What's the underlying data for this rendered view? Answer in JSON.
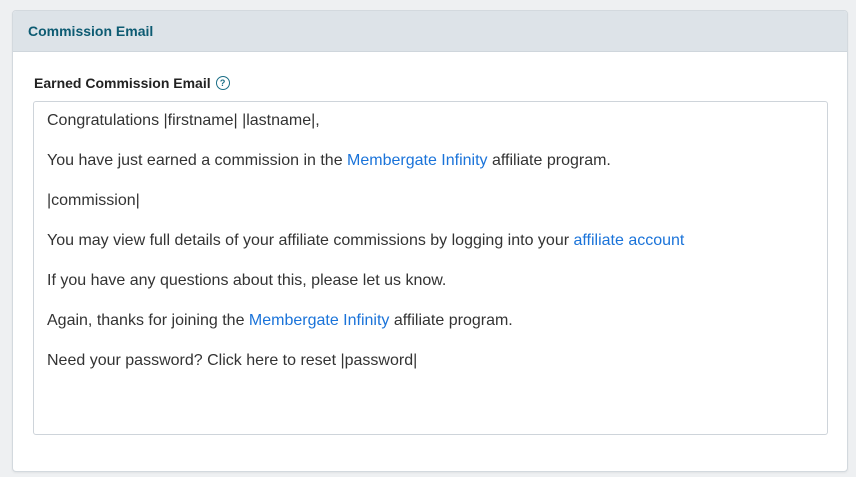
{
  "panel": {
    "title": "Commission Email"
  },
  "field": {
    "label": "Earned Commission Email",
    "help_icon": "question-circle-icon"
  },
  "email_body": {
    "line1": "Congratulations |firstname| |lastname|,",
    "line2_before": "You have just earned a commission in the ",
    "line2_link": "Membergate Infinity",
    "line2_after": " affiliate program.",
    "line3": "|commission|",
    "line4_before": "You may view full details of your affiliate commissions by logging into your ",
    "line4_link": "affiliate account",
    "line5": "If you have any questions about this, please let us know.",
    "line6_before": "Again, thanks for joining the ",
    "line6_link": "Membergate Infinity",
    "line6_after": " affiliate program.",
    "line7": "Need your password? Click here to reset |password|"
  },
  "colors": {
    "header_bg": "#dde3e8",
    "title": "#0d5b72",
    "link": "#1a73d9",
    "text": "#333333"
  }
}
